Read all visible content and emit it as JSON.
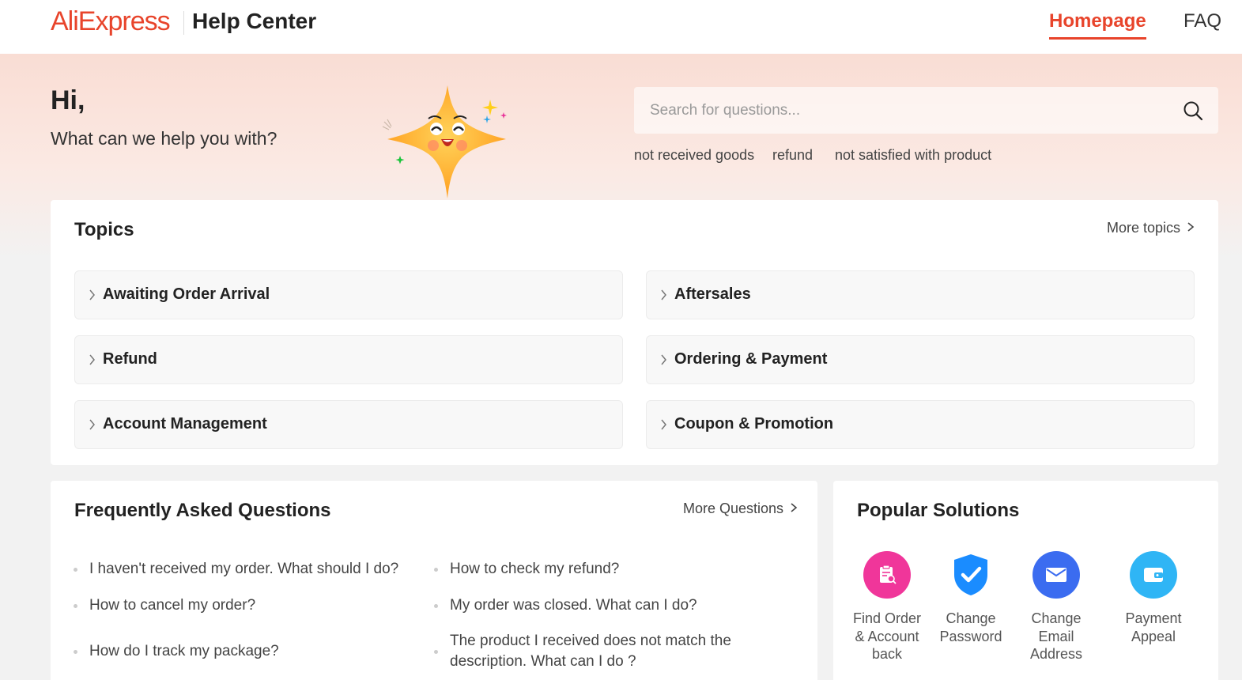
{
  "header": {
    "logo": "AliExpress",
    "title": "Help Center",
    "nav": {
      "homepage": "Homepage",
      "faq": "FAQ"
    }
  },
  "hero": {
    "greeting": "Hi,",
    "prompt": "What can we help you with?",
    "search_placeholder": "Search for questions...",
    "hot_words": [
      "not received goods",
      "refund",
      "not satisfied with product"
    ]
  },
  "topics": {
    "title": "Topics",
    "more": "More topics",
    "items": [
      "Awaiting Order Arrival",
      "Aftersales",
      "Refund",
      "Ordering & Payment",
      "Account Management",
      "Coupon & Promotion"
    ]
  },
  "faq": {
    "title": "Frequently Asked Questions",
    "more": "More Questions",
    "left": [
      "I haven't received my order. What should I do?",
      "How to cancel my order?",
      "How do I track my package?"
    ],
    "right": [
      "How to check my refund?",
      "My order was closed. What can I do?",
      "The product I received does not match the description. What can I do ?"
    ]
  },
  "popular": {
    "title": "Popular Solutions",
    "items": [
      {
        "label": "Find Order & Account back",
        "icon": "find-order-icon",
        "color": "#f0369a"
      },
      {
        "label": "Change Password",
        "icon": "shield-check-icon",
        "color": "#1a8cff"
      },
      {
        "label": "Change Email Address",
        "icon": "envelope-icon",
        "color": "#3b6cf0"
      },
      {
        "label": "Payment Appeal",
        "icon": "wallet-icon",
        "color": "#2fb5f5"
      }
    ]
  }
}
